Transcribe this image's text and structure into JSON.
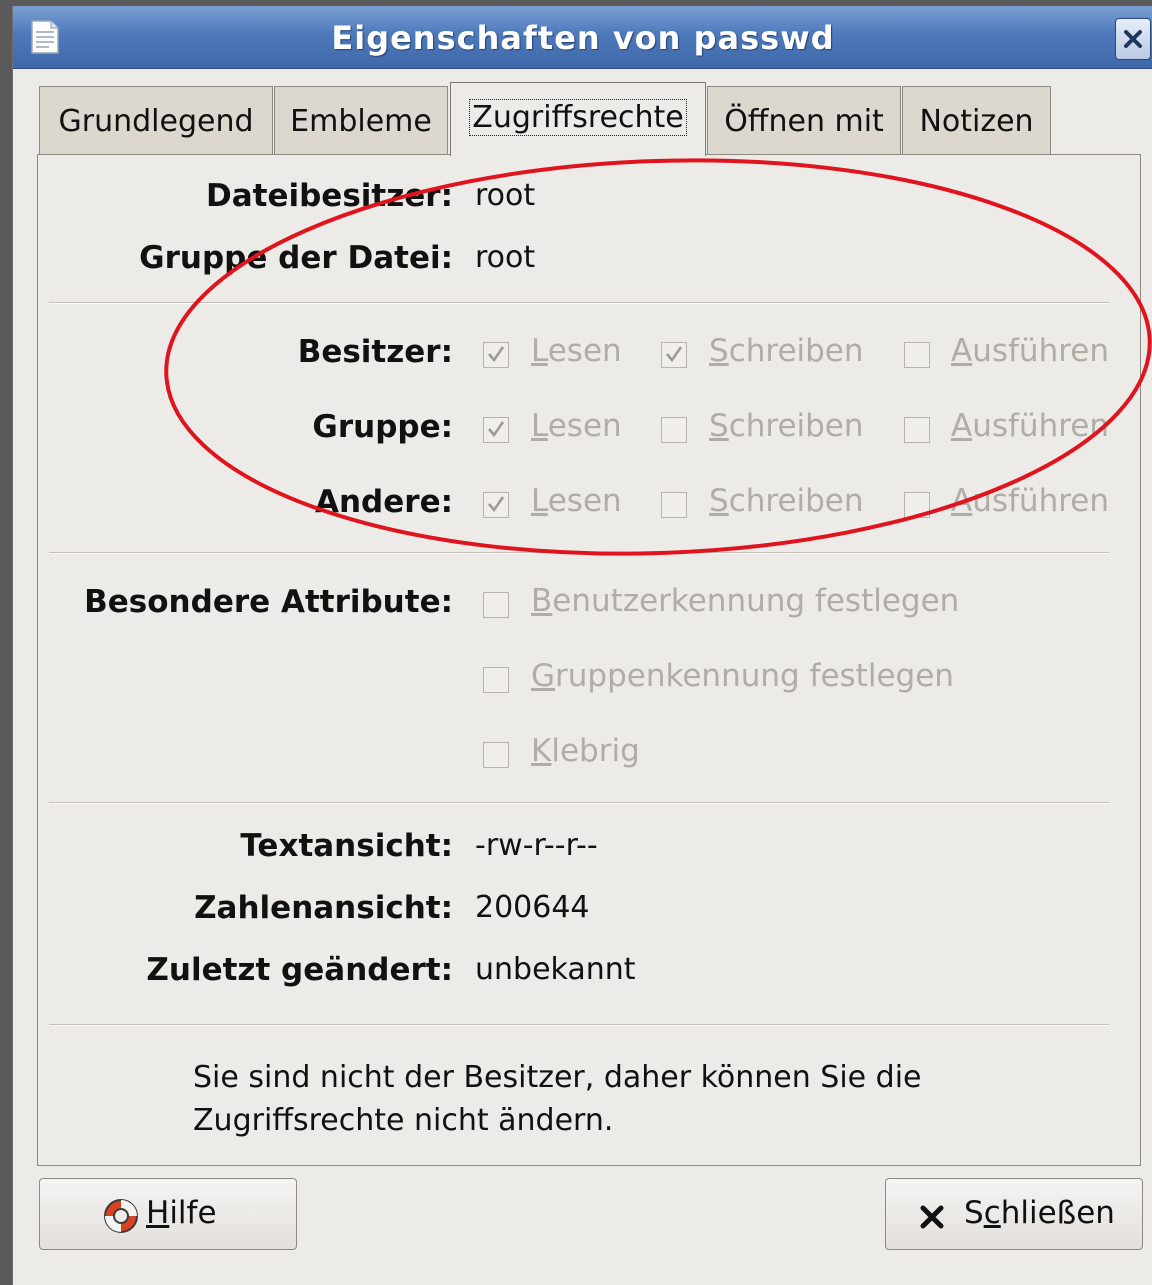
{
  "window": {
    "title": "Eigenschaften von passwd"
  },
  "tabs": [
    {
      "label": "Grundlegend"
    },
    {
      "label": "Embleme"
    },
    {
      "label": "Zugriffsrechte",
      "active": true
    },
    {
      "label": "Öffnen mit"
    },
    {
      "label": "Notizen"
    }
  ],
  "owner": {
    "label": "Dateibesitzer:",
    "value": "root"
  },
  "group": {
    "label": "Gruppe der Datei:",
    "value": "root"
  },
  "permissions": {
    "owner_label": "Besitzer:",
    "group_label": "Gruppe:",
    "others_label": "Andere:",
    "read": "Lesen",
    "read_u": "L",
    "read_rest": "esen",
    "write_u": "S",
    "write_rest": "chreiben",
    "exec_u": "A",
    "exec_rest": "usführen",
    "state": {
      "owner": {
        "read": true,
        "write": true,
        "execute": false
      },
      "group": {
        "read": true,
        "write": false,
        "execute": false
      },
      "others": {
        "read": true,
        "write": false,
        "execute": false
      }
    }
  },
  "special": {
    "label": "Besondere Attribute:",
    "setuid_u": "B",
    "setuid_rest": "enutzerkennung festlegen",
    "setgid_u": "G",
    "setgid_rest": "ruppenkennung festlegen",
    "sticky_u": "K",
    "sticky_rest": "lebrig",
    "state": {
      "setuid": false,
      "setgid": false,
      "sticky": false
    }
  },
  "text_view": {
    "label": "Textansicht:",
    "value": "-rw-r--r--"
  },
  "number_view": {
    "label": "Zahlenansicht:",
    "value": "200644"
  },
  "last_changed": {
    "label": "Zuletzt geändert:",
    "value": "unbekannt"
  },
  "message": {
    "line1": "Sie sind nicht der Besitzer, daher können Sie die",
    "line2": "Zugriffsrechte nicht ändern."
  },
  "buttons": {
    "help_u": "H",
    "help_rest": "ilfe",
    "close_pre": "S",
    "close_u": "c",
    "close_rest": "hließen"
  },
  "annotation_color": "#e0141e"
}
